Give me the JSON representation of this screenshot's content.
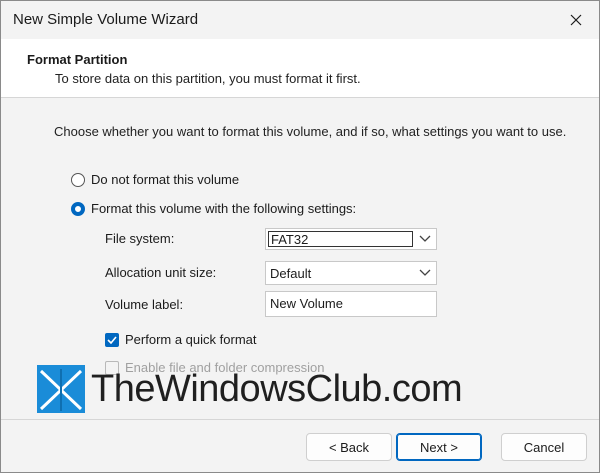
{
  "window": {
    "title": "New Simple Volume Wizard"
  },
  "header": {
    "title": "Format Partition",
    "subtitle": "To store data on this partition, you must format it first."
  },
  "instructions": "Choose whether you want to format this volume, and if so, what settings you want to use.",
  "options": {
    "no_format": {
      "label": "Do not format this volume",
      "selected": false
    },
    "format": {
      "label": "Format this volume with the following settings:",
      "selected": true
    }
  },
  "fields": {
    "file_system": {
      "label": "File system:",
      "value": "FAT32"
    },
    "allocation": {
      "label": "Allocation unit size:",
      "value": "Default"
    },
    "volume_label": {
      "label": "Volume label:",
      "value": "New Volume"
    }
  },
  "checks": {
    "quick_format": {
      "label": "Perform a quick format",
      "checked": true
    },
    "compression": {
      "label": "Enable file and folder compression",
      "checked": false,
      "enabled": false
    }
  },
  "watermark": {
    "text": "TheWindowsClub.com"
  },
  "buttons": {
    "back": "< Back",
    "next": "Next >",
    "cancel": "Cancel"
  },
  "colors": {
    "accent": "#0067c0",
    "watermark_logo": "#1a8cd8"
  }
}
